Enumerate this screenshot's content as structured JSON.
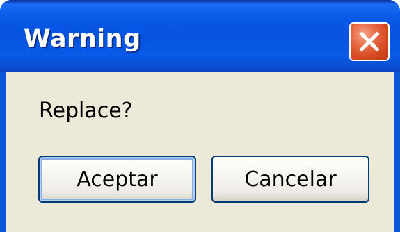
{
  "window": {
    "title": "Warning",
    "close_icon": "close-x-icon"
  },
  "dialog": {
    "message": "Replace?",
    "ok_label": "Aceptar",
    "cancel_label": "Cancelar"
  },
  "colors": {
    "titlebar": "#0553e0",
    "client_background": "#ece9d8",
    "close_button": "#e86a43"
  }
}
